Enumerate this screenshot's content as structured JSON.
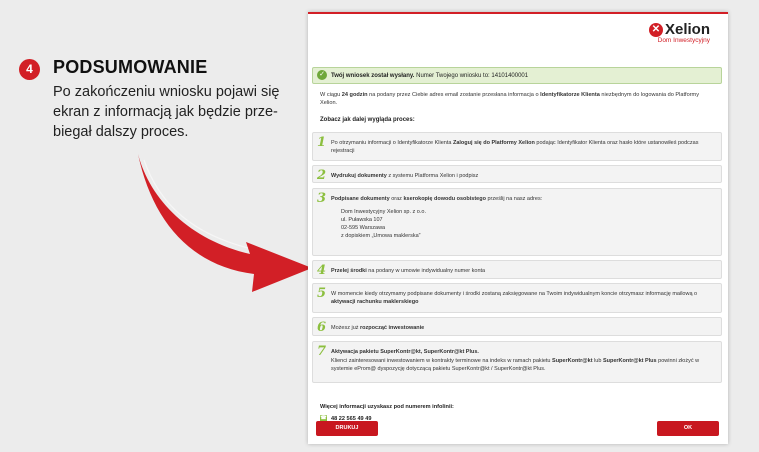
{
  "step": {
    "number": "4",
    "title": "PODSUMOWANIE",
    "description": "Po zakończeniu wniosku pojawi się ekran z informacją jak będzie prze-biegał dalszy proces."
  },
  "logo": {
    "name": "Xelion",
    "tagline": "Dom Inwestycyjny"
  },
  "success": {
    "strong": "Twój wniosek został wysłany.",
    "rest": " Numer Twojego wniosku to: 14101400001"
  },
  "intro": {
    "p1": "W ciągu ",
    "p1b": "24 godzin",
    "p2": " na podany przez Ciebie adres email zostanie przesłana informacja o ",
    "p2b": "Identyfikatorze Klienta",
    "p3": " niezbędnym do logowania do Platformy Xelion."
  },
  "subhead": "Zobacz jak dalej wygląda proces:",
  "steps": [
    {
      "n": "1",
      "a": "Po otrzymaniu informacji o Identyfikatorze Klienta ",
      "b": "Zaloguj się do Platformy Xelion",
      "c": " podając Identyfikator Klienta oraz hasło które ustanowiłeś podczas rejestracji"
    },
    {
      "n": "2",
      "a": "",
      "b": "Wydrukuj dokumenty",
      "c": " z systemu Platforma Xelion i podpisz"
    },
    {
      "n": "3",
      "a": "",
      "b": "Podpisane dokumenty",
      "c": " oraz ",
      "d": "kserokopię dowodu osobistego",
      "e": " prześlij na nasz adres:",
      "address": [
        "Dom Inwestycyjny Xelion sp. z o.o.",
        "ul. Puławska 107",
        "02-595 Warszawa",
        "z dopiskiem „Umowa maklerska”"
      ]
    },
    {
      "n": "4",
      "a": "",
      "b": "Przelej środki",
      "c": " na podany w umowie indywidualny numer konta"
    },
    {
      "n": "5",
      "a": "W momencie kiedy otrzymamy podpisane dokumenty i środki zostaną zaksięgowane na Twoim indywidualnym koncie otrzymasz informację mailową o ",
      "b": "aktywacji rachunku maklerskiego",
      "c": ""
    },
    {
      "n": "6",
      "a": "Możesz już ",
      "b": "rozpocząć inwestowanie",
      "c": ""
    },
    {
      "n": "7",
      "a": "",
      "b": "Aktywacja pakietu SuperKontr@kt, SuperKontr@kt Plus.",
      "c": "",
      "detail_a": "Klienci zainteresowani inwestowaniem w kontrakty terminowe na indeks w ramach pakietu ",
      "detail_b": "SuperKontr@kt",
      "detail_c": " lub ",
      "detail_d": "SuperKontr@kt Plus",
      "detail_e": " powinni złożyć w systemie eProm@ dyspozycję dotyczącą pakietu SuperKontr@kt / SuperKontr@kt Plus."
    }
  ],
  "help": "Więcej informacji uzyskasz pod numerem infolinii:",
  "phone": "48 22 565 49 49",
  "buttons": {
    "print": "DRUKUJ",
    "ok": "OK"
  },
  "colors": {
    "accent": "#d21f26",
    "green": "#8cbf3f",
    "success_bg": "#e4f0d3"
  }
}
